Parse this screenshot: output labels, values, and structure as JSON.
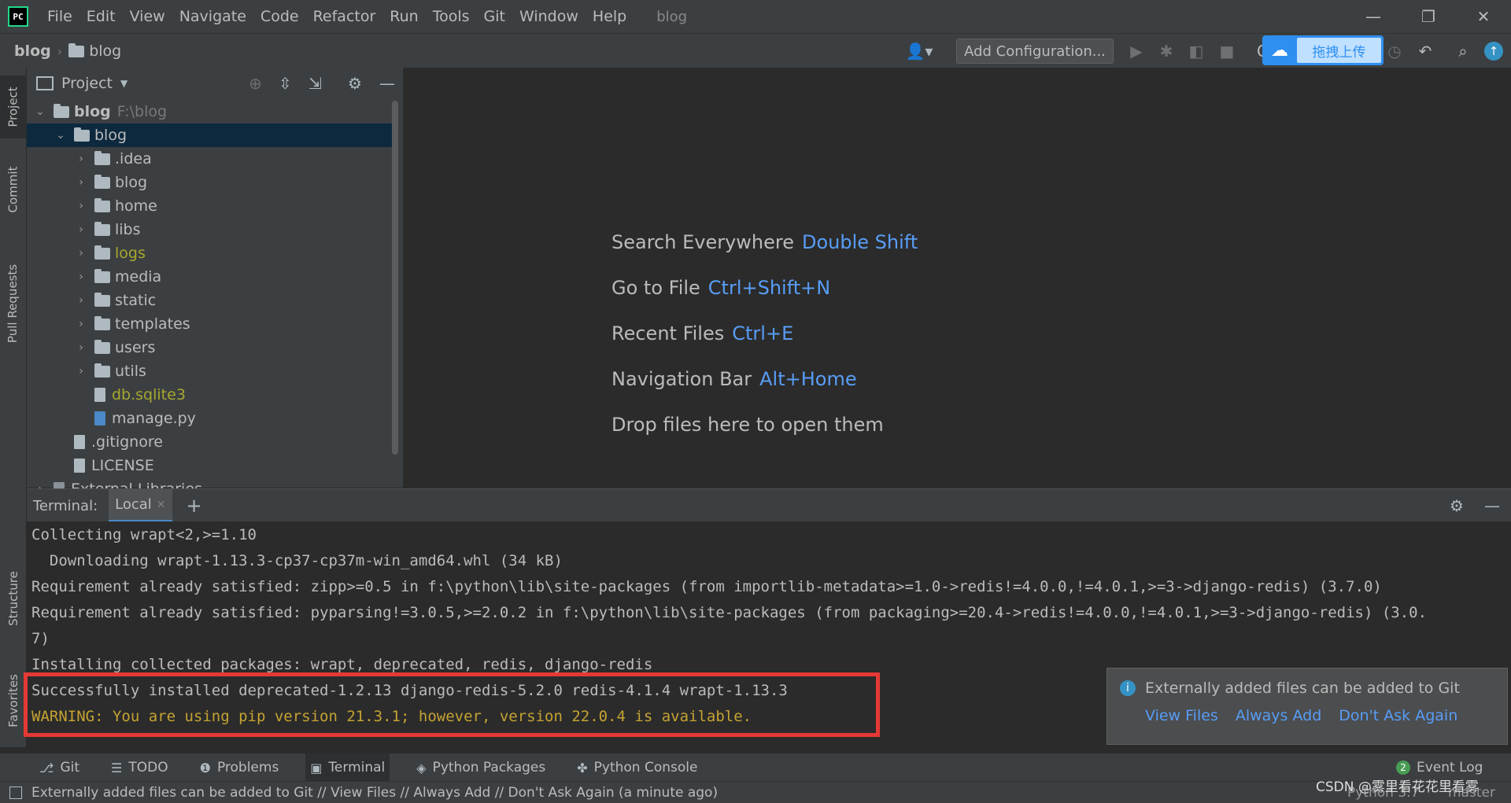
{
  "window": {
    "title": "blog",
    "menu": [
      "File",
      "Edit",
      "View",
      "Navigate",
      "Code",
      "Refactor",
      "Run",
      "Tools",
      "Git",
      "Window",
      "Help"
    ],
    "logo_text": "PC"
  },
  "navbar": {
    "crumbs": [
      "blog",
      "blog"
    ],
    "add_config": "Add Configuration...",
    "baidu_label": "拖拽上传",
    "baidu_partial": "C"
  },
  "left_strip": {
    "tabs": [
      "Project",
      "Commit",
      "Pull Requests",
      "Structure",
      "Favorites"
    ]
  },
  "project": {
    "header": "Project",
    "root": {
      "name": "blog",
      "path": "F:\\blog"
    },
    "tree": [
      {
        "label": "blog",
        "kind": "folder",
        "indent": 1,
        "expanded": true,
        "selected": true,
        "color": "#bbbbbb"
      },
      {
        "label": ".idea",
        "kind": "folder",
        "indent": 2,
        "color": "#bbbbbb"
      },
      {
        "label": "blog",
        "kind": "folder",
        "indent": 2,
        "color": "#bbbbbb"
      },
      {
        "label": "home",
        "kind": "folder",
        "indent": 2,
        "color": "#bbbbbb"
      },
      {
        "label": "libs",
        "kind": "folder",
        "indent": 2,
        "color": "#bbbbbb"
      },
      {
        "label": "logs",
        "kind": "folder",
        "indent": 2,
        "color": "#a7a72f"
      },
      {
        "label": "media",
        "kind": "folder",
        "indent": 2,
        "color": "#bbbbbb"
      },
      {
        "label": "static",
        "kind": "folder",
        "indent": 2,
        "color": "#bbbbbb"
      },
      {
        "label": "templates",
        "kind": "folder",
        "indent": 2,
        "color": "#bbbbbb"
      },
      {
        "label": "users",
        "kind": "folder",
        "indent": 2,
        "color": "#bbbbbb"
      },
      {
        "label": "utils",
        "kind": "folder",
        "indent": 2,
        "color": "#bbbbbb"
      },
      {
        "label": "db.sqlite3",
        "kind": "file",
        "indent": 2,
        "color": "#a7a72f"
      },
      {
        "label": "manage.py",
        "kind": "py",
        "indent": 2,
        "color": "#bbbbbb"
      },
      {
        "label": ".gitignore",
        "kind": "file",
        "indent": 1,
        "color": "#bbbbbb"
      },
      {
        "label": "LICENSE",
        "kind": "file",
        "indent": 1,
        "color": "#bbbbbb"
      },
      {
        "label": "External Libraries",
        "kind": "lib",
        "indent": 0,
        "color": "#bbbbbb"
      }
    ]
  },
  "editor": {
    "hints": [
      {
        "label": "Search Everywhere",
        "key": "Double Shift"
      },
      {
        "label": "Go to File",
        "key": "Ctrl+Shift+N"
      },
      {
        "label": "Recent Files",
        "key": "Ctrl+E"
      },
      {
        "label": "Navigation Bar",
        "key": "Alt+Home"
      },
      {
        "label": "Drop files here to open them",
        "key": ""
      }
    ]
  },
  "terminal": {
    "title": "Terminal:",
    "tab": "Local",
    "lines": [
      {
        "text": "Collecting wrapt<2,>=1.10",
        "color": "#bbbbbb"
      },
      {
        "text": "  Downloading wrapt-1.13.3-cp37-cp37m-win_amd64.whl (34 kB)",
        "color": "#bbbbbb"
      },
      {
        "text": "Requirement already satisfied: zipp>=0.5 in f:\\python\\lib\\site-packages (from importlib-metadata>=1.0->redis!=4.0.0,!=4.0.1,>=3->django-redis) (3.7.0)",
        "color": "#bbbbbb"
      },
      {
        "text": "Requirement already satisfied: pyparsing!=3.0.5,>=2.0.2 in f:\\python\\lib\\site-packages (from packaging>=20.4->redis!=4.0.0,!=4.0.1,>=3->django-redis) (3.0.",
        "color": "#bbbbbb"
      },
      {
        "text": "7)",
        "color": "#bbbbbb"
      },
      {
        "text": "Installing collected packages: wrapt, deprecated, redis, django-redis",
        "color": "#bbbbbb"
      },
      {
        "text": "Successfully installed deprecated-1.2.13 django-redis-5.2.0 redis-4.1.4 wrapt-1.13.3",
        "color": "#bbbbbb"
      },
      {
        "text": "WARNING: You are using pip version 21.3.1; however, version 22.0.4 is available.",
        "color": "#c5a332"
      }
    ]
  },
  "notification": {
    "message": "Externally added files can be added to Git",
    "links": [
      "View Files",
      "Always Add",
      "Don't Ask Again"
    ]
  },
  "bottom_tabs": [
    {
      "label": "Git",
      "icon": "git-branch-icon",
      "glyph": "⎇"
    },
    {
      "label": "TODO",
      "icon": "todo-list-icon",
      "glyph": "☰"
    },
    {
      "label": "Problems",
      "icon": "problems-icon",
      "glyph": "❶"
    },
    {
      "label": "Terminal",
      "icon": "terminal-icon",
      "glyph": "▣",
      "active": true
    },
    {
      "label": "Python Packages",
      "icon": "packages-icon",
      "glyph": "◈"
    },
    {
      "label": "Python Console",
      "icon": "python-console-icon",
      "glyph": "✤"
    }
  ],
  "event_log": {
    "label": "Event Log",
    "count": "2"
  },
  "statusbar": {
    "message": "Externally added files can be added to Git // View Files // Always Add // Don't Ask Again (a minute ago)",
    "right": "Python 3.7",
    "branch": "master",
    "watermark": "CSDN @雾里看花花里看雾"
  }
}
